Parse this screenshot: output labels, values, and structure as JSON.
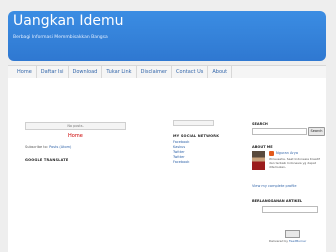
{
  "header": {
    "title": "Uangkan Idemu",
    "description": "Berbagi Informasi Memmbisakkan Bangsa"
  },
  "nav": {
    "items": [
      "Home",
      "Daftar Isi",
      "Download",
      "Tukar Link",
      "Disclaimer",
      "Contact Us",
      "About"
    ]
  },
  "main": {
    "posts_label": "No posts.",
    "home_link": "Home",
    "subscribe_prefix": "Subscribe to:",
    "subscribe_link": "Posts (Atom)",
    "google_translate_heading": "GOOGLE TRANSLATE"
  },
  "social": {
    "heading": "MY SOCIAL NETWORK",
    "links": [
      "Facebook",
      "Kaskus",
      "Twitter",
      "Twitter",
      "Facebook"
    ]
  },
  "sidebar": {
    "search_heading": "SEARCH",
    "search_button": "Search",
    "about_heading": "ABOUT ME",
    "profile_name": "Nguran Arya",
    "profile_description": "Wirausaha. Saat Indonesia Kreatif dan terbaik Indonesia yg dapat ditemukan-",
    "view_profile": "View my complete profile",
    "subscribe_heading": "BERLANGGANAN ARTIKEL",
    "delivered_by_prefix": "Delivered by",
    "delivered_by_link": "FeedBurner"
  },
  "colors": {
    "header_blue": "#3b8de3",
    "link_blue": "#3366aa",
    "home_red": "#cc0000",
    "profile_orange": "#e25a1c"
  }
}
